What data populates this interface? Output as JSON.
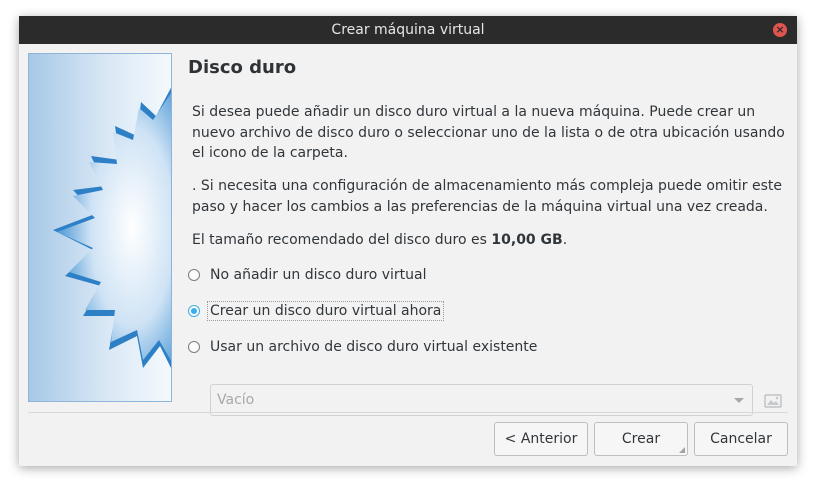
{
  "window": {
    "title": "Crear máquina virtual",
    "close_icon": "close-icon"
  },
  "page": {
    "heading": "Disco duro",
    "paragraph1": "Si desea puede añadir un disco duro virtual a la nueva máquina. Puede crear un nuevo archivo de disco duro o seleccionar uno de la lista o de otra ubicación usando el icono de la carpeta.",
    "paragraph2": ". Si necesita una configuración de almacenamiento más compleja puede omitir este paso y hacer los cambios a las preferencias de la máquina virtual una vez creada.",
    "recommended_prefix": "El tamaño recomendado del disco duro es ",
    "recommended_size": "10,00 GB",
    "recommended_suffix": "."
  },
  "options": [
    {
      "label": "No añadir un disco duro virtual",
      "selected": false
    },
    {
      "label": "Crear un disco duro virtual ahora",
      "selected": true
    },
    {
      "label": "Usar un archivo de disco duro virtual existente",
      "selected": false
    }
  ],
  "disk_select": {
    "value": "Vacío",
    "enabled": false
  },
  "buttons": {
    "back": "< Anterior",
    "create": "Crear",
    "cancel": "Cancelar"
  },
  "colors": {
    "accent": "#3daee9",
    "titlebar": "#2b2b2b",
    "close": "#e0554f"
  }
}
